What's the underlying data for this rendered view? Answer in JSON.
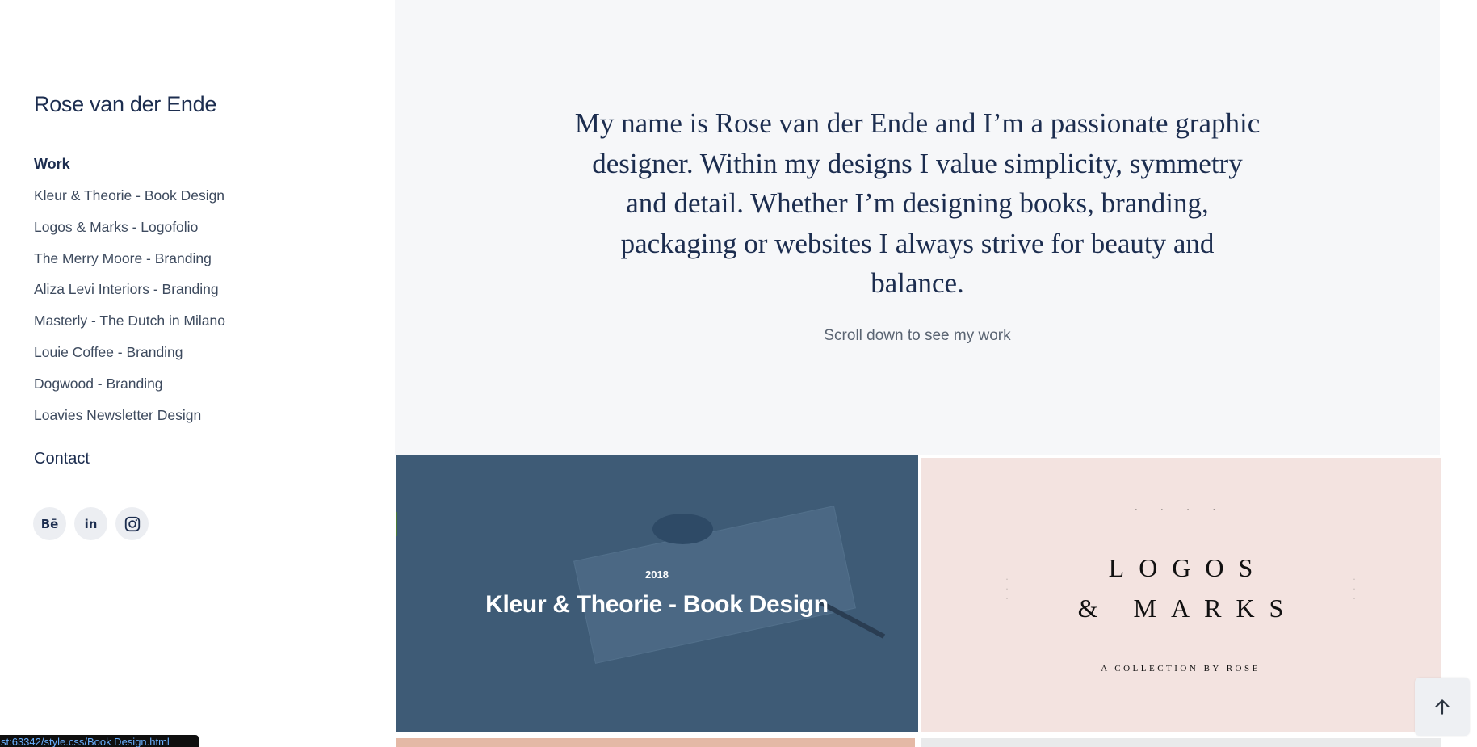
{
  "sidebar": {
    "site_title": "Rose van der Ende",
    "work_heading": "Work",
    "items": [
      "Kleur & Theorie - Book Design",
      "Logos & Marks - Logofolio",
      "The Merry Moore - Branding",
      "Aliza Levi Interiors - Branding",
      "Masterly - The Dutch in Milano",
      "Louie Coffee - Branding",
      "Dogwood - Branding",
      "Loavies Newsletter Design"
    ],
    "contact_heading": "Contact",
    "socials": [
      {
        "name": "behance-icon",
        "glyph": "Bē"
      },
      {
        "name": "linkedin-icon",
        "glyph": "in"
      },
      {
        "name": "instagram-icon",
        "glyph": ""
      }
    ]
  },
  "hero": {
    "intro": "My name is Rose van der Ende and I’m a passionate graphic designer. Within my designs I value simplicity, symmetry and detail. Whether I’m designing books, branding, packaging or websites I always strive for beauty and balance.",
    "scroll_hint": "Scroll down to see my work"
  },
  "tiles": {
    "book": {
      "year": "2018",
      "title": "Kleur & Theorie - Book Design"
    },
    "logos": {
      "line1": "LOGOS",
      "line2": "& MARKS",
      "subtitle": "A COLLECTION BY ROSE",
      "background": "#f3e3e0"
    }
  },
  "status_bar": {
    "url": "st:63342/style.css/Book Design.html"
  },
  "colors": {
    "navy": "#1c2d4f",
    "hero_bg": "#f6f7f9",
    "book_overlay": "#3e5b76"
  }
}
